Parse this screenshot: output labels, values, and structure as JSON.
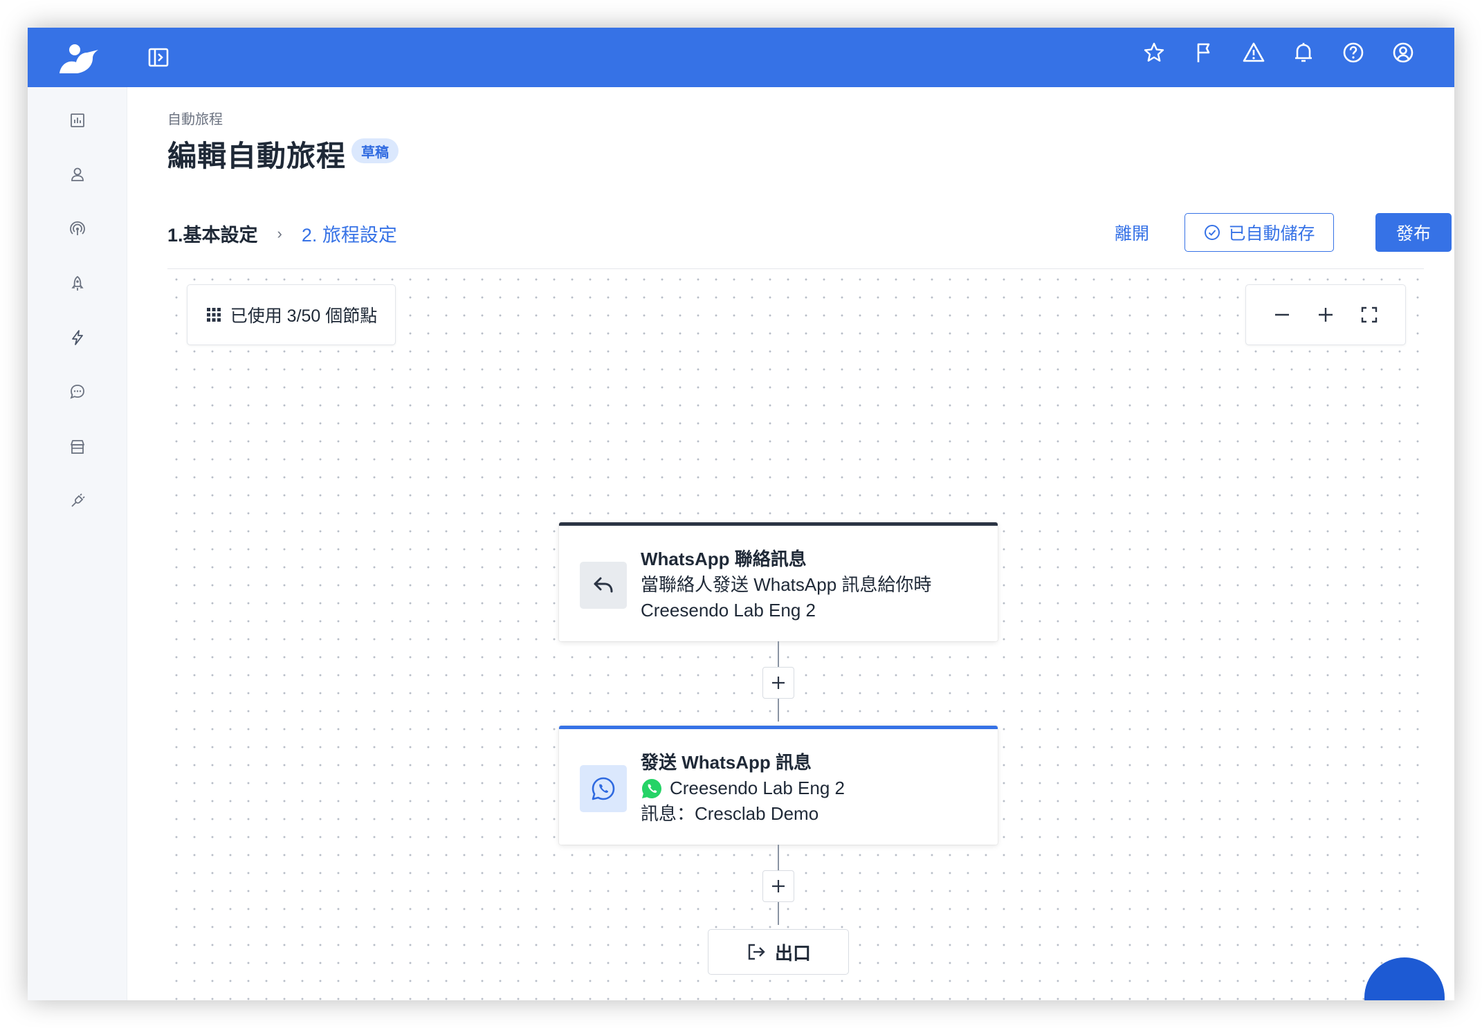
{
  "topbar": {
    "icons": [
      "sidebar-toggle-icon",
      "star-icon",
      "flag-icon",
      "warning-icon",
      "bell-icon",
      "help-icon",
      "user-circle-icon"
    ]
  },
  "rail": {
    "items": [
      "chart-icon",
      "contact-icon",
      "broadcast-icon",
      "rocket-icon",
      "lightning-icon",
      "chat-bubble-icon",
      "store-icon",
      "plug-icon"
    ]
  },
  "header": {
    "breadcrumb": "自動旅程",
    "title": "編輯自動旅程",
    "badge": "草稿",
    "step1": "1.基本設定",
    "step_separator": "›",
    "step2": "2. 旅程設定",
    "leave": "離開",
    "autosaved": "已自動儲存",
    "publish": "發布"
  },
  "canvas": {
    "node_count": "已使用 3/50 個節點",
    "zoom_out": "−",
    "zoom_in": "+",
    "fit": "fit-screen-icon"
  },
  "nodes": [
    {
      "title": "WhatsApp 聯絡訊息",
      "line1": "當聯絡人發送 WhatsApp 訊息給你時",
      "line2": "Creesendo Lab Eng 2",
      "icon": "reply-arrow-icon",
      "accent": "#2b3444"
    },
    {
      "title": "發送 WhatsApp 訊息",
      "line1": "Creesendo Lab Eng 2",
      "line2": "訊息：Cresclab Demo",
      "icon": "whatsapp-icon",
      "accent": "#3672e6"
    }
  ],
  "exit": {
    "label": "出口"
  },
  "colors": {
    "brand": "#3672e6",
    "whatsapp_green": "#25d366"
  }
}
